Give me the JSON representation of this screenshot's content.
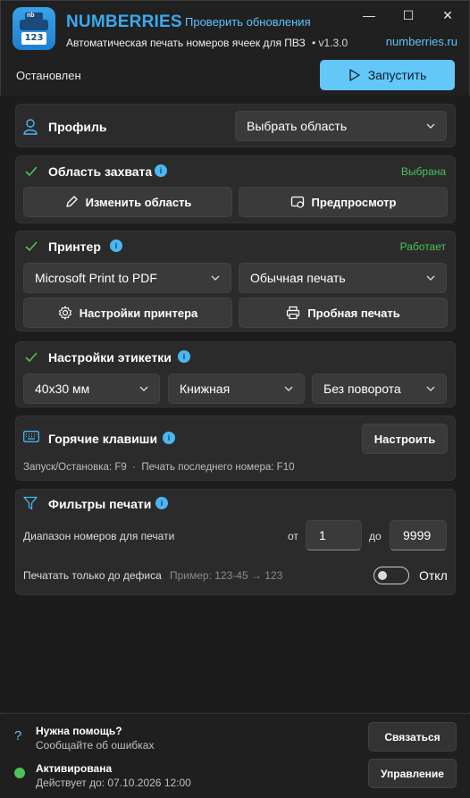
{
  "header": {
    "app_title": "NUMBERRIES",
    "check_updates": "Проверить обновления",
    "subtitle": "Автоматическая печать номеров ячеек для ПВЗ",
    "version": "• v1.3.0",
    "site": "numberries.ru",
    "logo_label": "123",
    "logo_tag": "nb",
    "window_buttons": [
      "—",
      "☐",
      "✕"
    ]
  },
  "toolbar": {
    "status": "Остановлен",
    "start_label": "Запустить"
  },
  "profile": {
    "title": "Профиль",
    "select_value": "Выбрать область"
  },
  "capture": {
    "title": "Область захвата",
    "status": "Выбрана",
    "change_label": "Изменить область",
    "preview_label": "Предпросмотр"
  },
  "printer": {
    "title": "Принтер",
    "status": "Работает",
    "printer_value": "Microsoft Print to PDF",
    "mode_value": "Обычная печать",
    "settings_label": "Настройки принтера",
    "test_label": "Пробная печать"
  },
  "label": {
    "title": "Настройки этикетки",
    "size_value": "40x30 мм",
    "orientation_value": "Книжная",
    "rotation_value": "Без поворота"
  },
  "hotkeys": {
    "title": "Горячие клавиши",
    "configure_label": "Настроить",
    "description": "Запуск/Остановка: F9  ·  Печать последнего номера: F10"
  },
  "filters": {
    "title": "Фильтры печати",
    "range_label": "Диапазон номеров для печати",
    "from_label": "от",
    "from_value": "1",
    "to_label": "до",
    "to_value": "9999",
    "hyphen_label": "Печатать только до дефиса",
    "hyphen_example": "Пример: 123-45 → 123",
    "toggle_state": "Откл"
  },
  "footer": {
    "help_title": "Нужна помощь?",
    "help_sub": "Сообщайте об ошибках",
    "contact_label": "Связаться",
    "activation_title": "Активирована",
    "activation_sub": "Действует до: 07.10.2026 12:00",
    "manage_label": "Управление"
  },
  "colors": {
    "accent": "#63c8f8",
    "link": "#5cc3ff",
    "ok": "#4cc25b",
    "card": "#2b2b2b",
    "background": "#202020"
  }
}
